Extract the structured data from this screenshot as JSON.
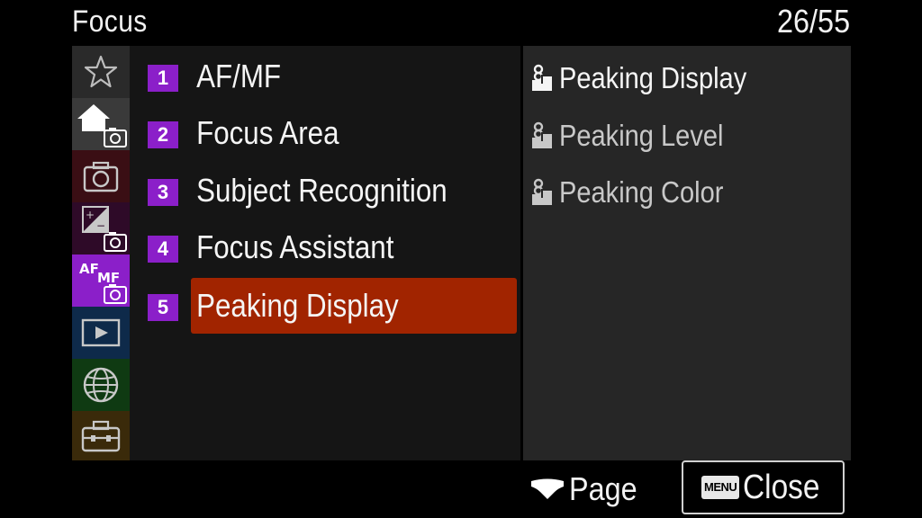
{
  "header": {
    "title": "Focus",
    "page_indicator": "26/55"
  },
  "tabs": [
    {
      "icon": "star-icon",
      "color": "#2a2a2a"
    },
    {
      "icon": "home-camera-icon",
      "color": "#3a3a3a"
    },
    {
      "icon": "camera-icon",
      "color": "#3a0e14"
    },
    {
      "icon": "exposure-camera-icon",
      "color": "#2e0a28"
    },
    {
      "icon": "af-mf-camera-icon",
      "color": "#8b1fc9",
      "text": "AF",
      "subtext": "MF"
    },
    {
      "icon": "playback-icon",
      "color": "#0e2a4a"
    },
    {
      "icon": "globe-icon",
      "color": "#0f3a12"
    },
    {
      "icon": "toolbox-icon",
      "color": "#3a2a0a"
    }
  ],
  "menu": {
    "items": [
      {
        "number": "1",
        "label": "AF/MF"
      },
      {
        "number": "2",
        "label": "Focus Area"
      },
      {
        "number": "3",
        "label": "Subject Recognition"
      },
      {
        "number": "4",
        "label": "Focus Assistant"
      },
      {
        "number": "5",
        "label": "Peaking Display"
      }
    ],
    "selected_index": 4
  },
  "submenu": {
    "items": [
      {
        "label": "Peaking Display",
        "icon": "movie-photo-icon"
      },
      {
        "label": "Peaking Level",
        "icon": "movie-photo-icon"
      },
      {
        "label": "Peaking Color",
        "icon": "movie-photo-icon"
      }
    ]
  },
  "footer": {
    "page_label": "Page",
    "page_icon": "control-wheel-icon",
    "close_key": "MENU",
    "close_label": "Close"
  }
}
